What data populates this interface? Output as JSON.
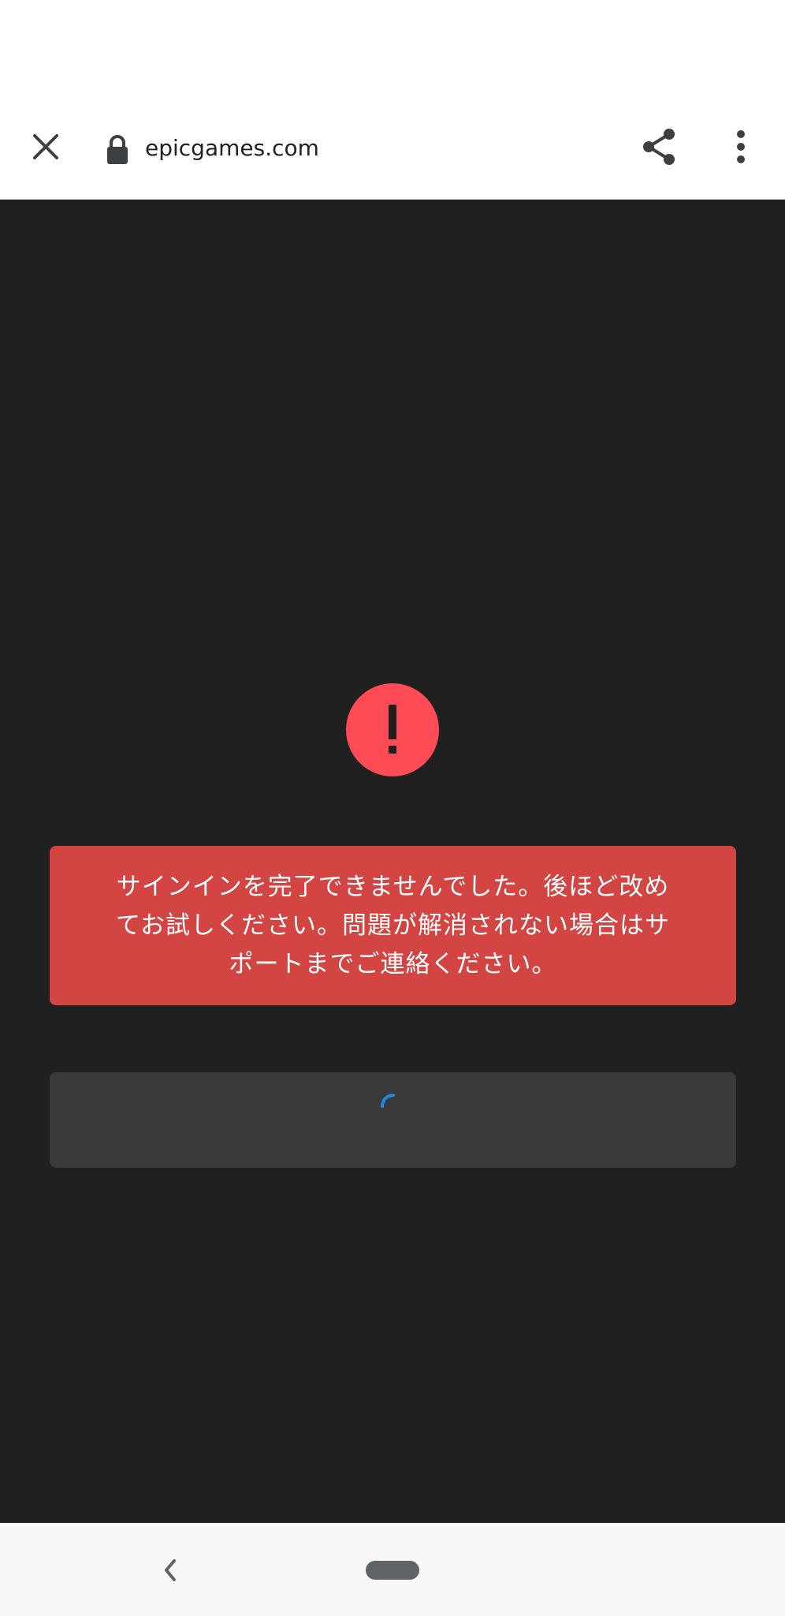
{
  "browser": {
    "url": "epicgames.com",
    "icons": {
      "close": "close-icon",
      "lock": "lock-icon",
      "share": "share-icon",
      "menu": "more-vert-icon"
    }
  },
  "error": {
    "icon": "exclamation-icon",
    "mark": "!",
    "message": "サインインを完了できませんでした。後ほど改めてお試しください。問題が解消されない場合はサポートまでご連絡ください。"
  },
  "loading": {
    "icon": "spinner-icon"
  },
  "nav": {
    "back_icon": "chevron-left-icon",
    "home_icon": "home-pill-icon"
  },
  "colors": {
    "content_bg": "#202020",
    "error_circle": "#ff4b55",
    "error_box": "#d34542",
    "loading_box": "#3a3a3a",
    "spinner": "#1e88e5"
  }
}
